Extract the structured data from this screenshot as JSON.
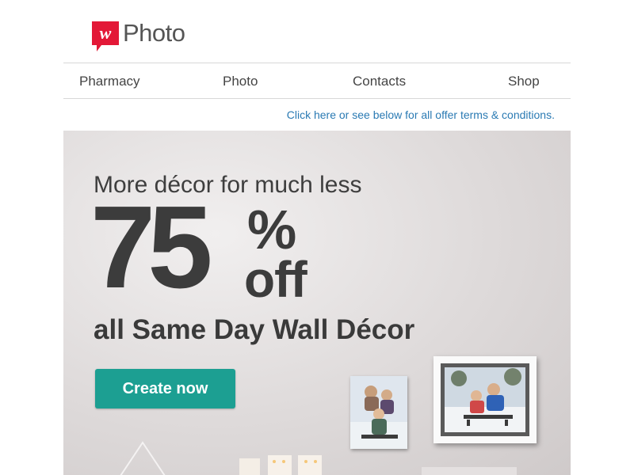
{
  "brand": {
    "logo_text": "Photo",
    "logo_icon": "walgreens-w-icon",
    "accent_color": "#e31837"
  },
  "nav": {
    "items": [
      {
        "label": "Pharmacy"
      },
      {
        "label": "Photo"
      },
      {
        "label": "Contacts"
      },
      {
        "label": "Shop"
      }
    ]
  },
  "terms_link": "Click here or see below for all offer terms & conditions.",
  "hero": {
    "subtitle": "More décor for much less",
    "discount_number": "75",
    "discount_symbol": "%",
    "discount_word": "off",
    "offer_line": "all Same Day Wall Décor",
    "cta_label": "Create now",
    "cta_color": "#1c9f92"
  }
}
